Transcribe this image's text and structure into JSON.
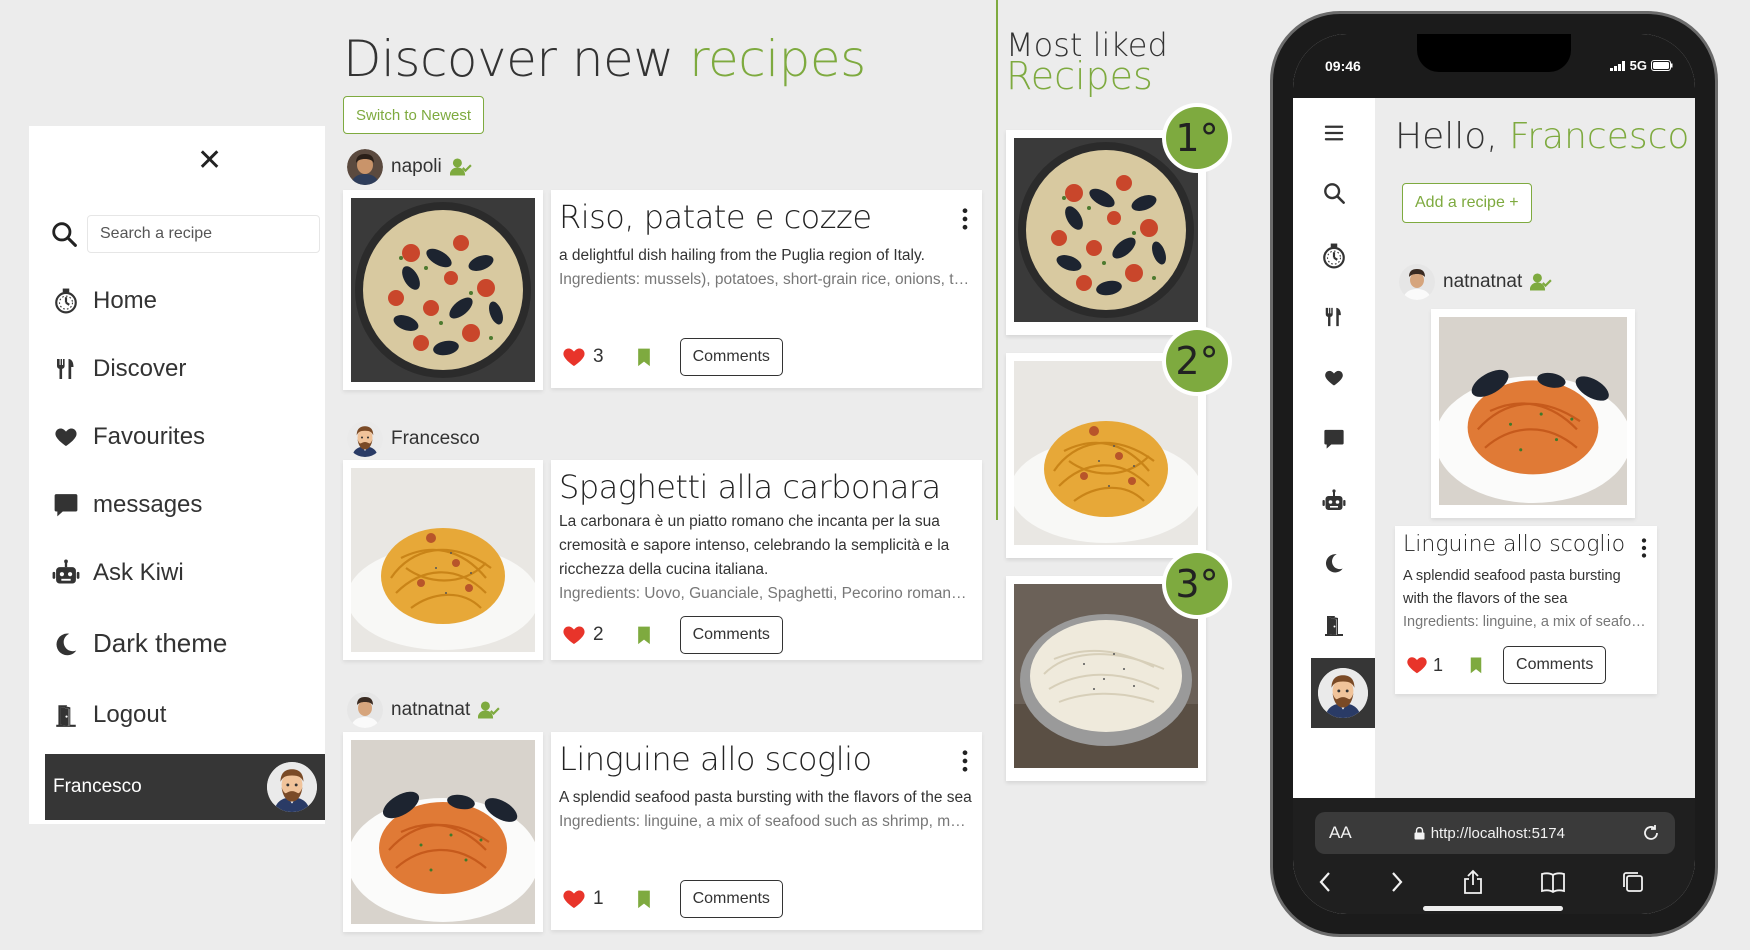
{
  "sidebar": {
    "search_placeholder": "Search a recipe",
    "items": [
      {
        "label": "Home",
        "icon": "stopwatch-icon"
      },
      {
        "label": "Discover",
        "icon": "utensils-icon"
      },
      {
        "label": "Favourites",
        "icon": "heart-icon"
      },
      {
        "label": "messages",
        "icon": "message-icon"
      },
      {
        "label": "Ask Kiwi",
        "icon": "robot-icon"
      },
      {
        "label": "Dark theme",
        "icon": "moon-icon"
      },
      {
        "label": "Logout",
        "icon": "door-icon"
      }
    ],
    "user_name": "Francesco"
  },
  "feed": {
    "title_prefix": "Discover new",
    "title_highlight": "recipes",
    "switch_label": "Switch to Newest",
    "posts": [
      {
        "author": "napoli",
        "title": "Riso, patate e cozze",
        "description": "a delightful dish hailing from the Puglia region of Italy.",
        "ingredients": "Ingredients: mussels), potatoes, short-grain rice, onions, tomatoes, garlic, pecorino, parsley, olive oil",
        "likes": "3",
        "comments_label": "Comments"
      },
      {
        "author": "Francesco",
        "title": "Spaghetti alla carbonara",
        "description": "La carbonara è un piatto romano che incanta per la sua cremosità e sapore intenso, celebrando la semplicità e la ricchezza della cucina italiana.",
        "ingredients": "Ingredients: Uovo, Guanciale, Spaghetti, Pecorino romano, pepe nero",
        "likes": "2",
        "comments_label": "Comments"
      },
      {
        "author": "natnatnat",
        "title": "Linguine allo scoglio",
        "description": "A splendid seafood pasta bursting with the flavors of the sea",
        "ingredients": "Ingredients: linguine, a mix of seafood such as shrimp, mussels, clams, squid",
        "likes": "1",
        "comments_label": "Comments"
      }
    ]
  },
  "most_liked": {
    "title_line1": "Most liked",
    "title_line2": "Recipes",
    "ranks": [
      "1°",
      "2°",
      "3°"
    ]
  },
  "phone": {
    "time": "09:46",
    "network": "5G",
    "greeting": "Hello,",
    "user_name": "Francesco",
    "add_label": "Add a recipe +",
    "post": {
      "author": "natnatnat",
      "title": "Linguine allo scoglio",
      "description": "A splendid seafood pasta bursting with the flavors of the sea",
      "ingredients": "Ingredients: linguine, a mix of seafood such as shrimp, mussels",
      "likes": "1",
      "comments_label": "Comments"
    },
    "browser": {
      "aa": "AA",
      "url": "http://localhost:5174"
    }
  },
  "colors": {
    "accent": "#7eaa3f",
    "dark": "#363636",
    "heart": "#e8342a"
  }
}
